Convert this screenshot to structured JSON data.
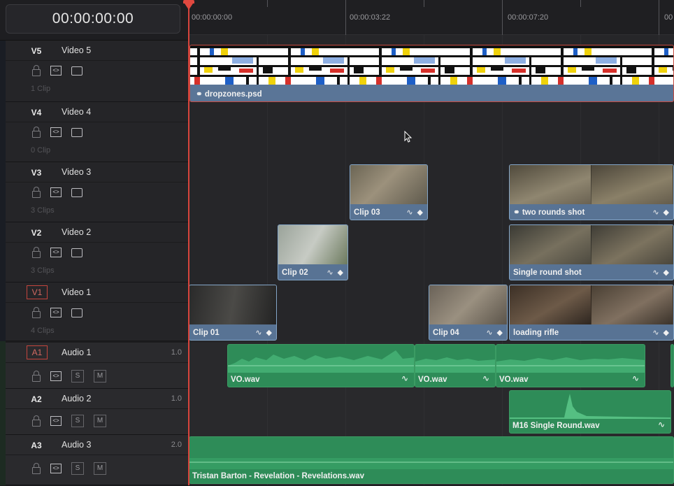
{
  "timecode": "00:00:00:00",
  "ruler": {
    "labels": [
      "00:00:00:00",
      "00:00:03:22",
      "00:00:07:20",
      "00"
    ]
  },
  "video_tracks": [
    {
      "id": "V5",
      "name": "Video 5",
      "count": "1 Clip",
      "selected": false
    },
    {
      "id": "V4",
      "name": "Video 4",
      "count": "0 Clip",
      "selected": false
    },
    {
      "id": "V3",
      "name": "Video 3",
      "count": "3 Clips",
      "selected": false
    },
    {
      "id": "V2",
      "name": "Video 2",
      "count": "3 Clips",
      "selected": false
    },
    {
      "id": "V1",
      "name": "Video 1",
      "count": "4 Clips",
      "selected": true
    }
  ],
  "audio_tracks": [
    {
      "id": "A1",
      "name": "Audio 1",
      "level": "1.0",
      "selected": true,
      "solo": "S",
      "mute": "M"
    },
    {
      "id": "A2",
      "name": "Audio 2",
      "level": "1.0",
      "selected": false,
      "solo": "S",
      "mute": "M"
    },
    {
      "id": "A3",
      "name": "Audio 3",
      "level": "2.0",
      "selected": false,
      "solo": "S",
      "mute": "M"
    }
  ],
  "clips": {
    "v5": {
      "name": "dropzones.psd"
    },
    "clip03": {
      "name": "Clip 03"
    },
    "two_rounds": {
      "name": "two rounds shot"
    },
    "clip02": {
      "name": "Clip 02"
    },
    "single_round": {
      "name": "Single round shot"
    },
    "clip01": {
      "name": "Clip 01"
    },
    "clip04": {
      "name": "Clip 04"
    },
    "loading_rifle": {
      "name": "loading rifle"
    },
    "vo1": {
      "name": "VO.wav"
    },
    "vo2": {
      "name": "VO.wav"
    },
    "vo3": {
      "name": "VO.wav"
    },
    "m16": {
      "name": "M16 Single Round.wav"
    },
    "music": {
      "name": "Tristan Barton - Revelation - Revelations.wav"
    }
  },
  "colors": {
    "video_clip": "#587394",
    "audio_clip": "#2e8c58",
    "playhead": "#e0483f"
  }
}
